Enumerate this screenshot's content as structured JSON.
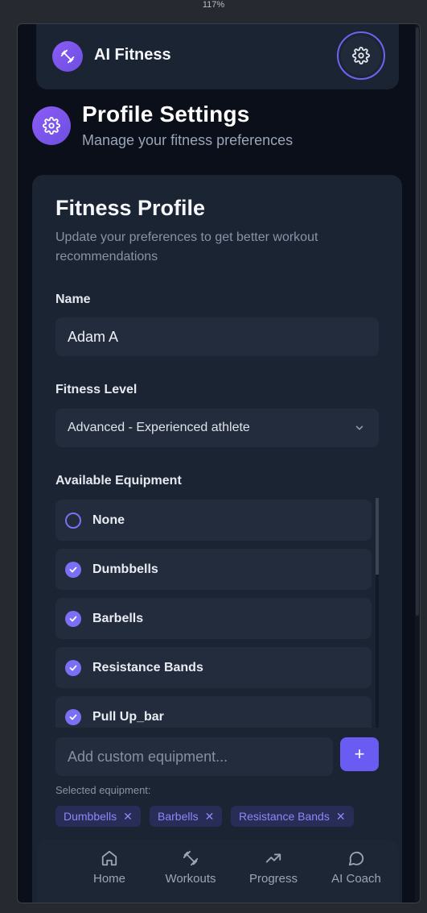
{
  "browser": {
    "zoom": "117%"
  },
  "header": {
    "app_title": "AI Fitness",
    "logo_icon": "dumbbell-icon",
    "settings_icon": "gear-icon"
  },
  "page": {
    "title": "Profile Settings",
    "subtitle": "Manage your fitness preferences",
    "icon": "gear-icon"
  },
  "profile_card": {
    "title": "Fitness Profile",
    "description": "Update your preferences to get better workout recommendations",
    "name_label": "Name",
    "name_value": "Adam A",
    "fitness_level_label": "Fitness Level",
    "fitness_level_value": "Advanced - Experienced athlete",
    "equipment_label": "Available Equipment",
    "equipment_items": [
      {
        "label": "None",
        "checked": false
      },
      {
        "label": "Dumbbells",
        "checked": true
      },
      {
        "label": "Barbells",
        "checked": true
      },
      {
        "label": "Resistance Bands",
        "checked": true
      },
      {
        "label": "Pull Up_bar",
        "checked": true
      }
    ],
    "custom_equipment_placeholder": "Add custom equipment...",
    "add_button_label": "+",
    "selected_label": "Selected equipment:",
    "selected_chips": [
      "Dumbbells",
      "Barbells",
      "Resistance Bands"
    ],
    "chip_remove": "✕"
  },
  "bottom_nav": [
    {
      "label": "Home",
      "icon": "home-icon"
    },
    {
      "label": "Workouts",
      "icon": "dumbbell-icon"
    },
    {
      "label": "Progress",
      "icon": "trending-up-icon"
    },
    {
      "label": "AI Coach",
      "icon": "chat-bubble-icon"
    }
  ],
  "colors": {
    "accent": "#6a5cf2",
    "background": "#0a0f1a",
    "card": "#1b2433",
    "field": "#222c3c"
  }
}
